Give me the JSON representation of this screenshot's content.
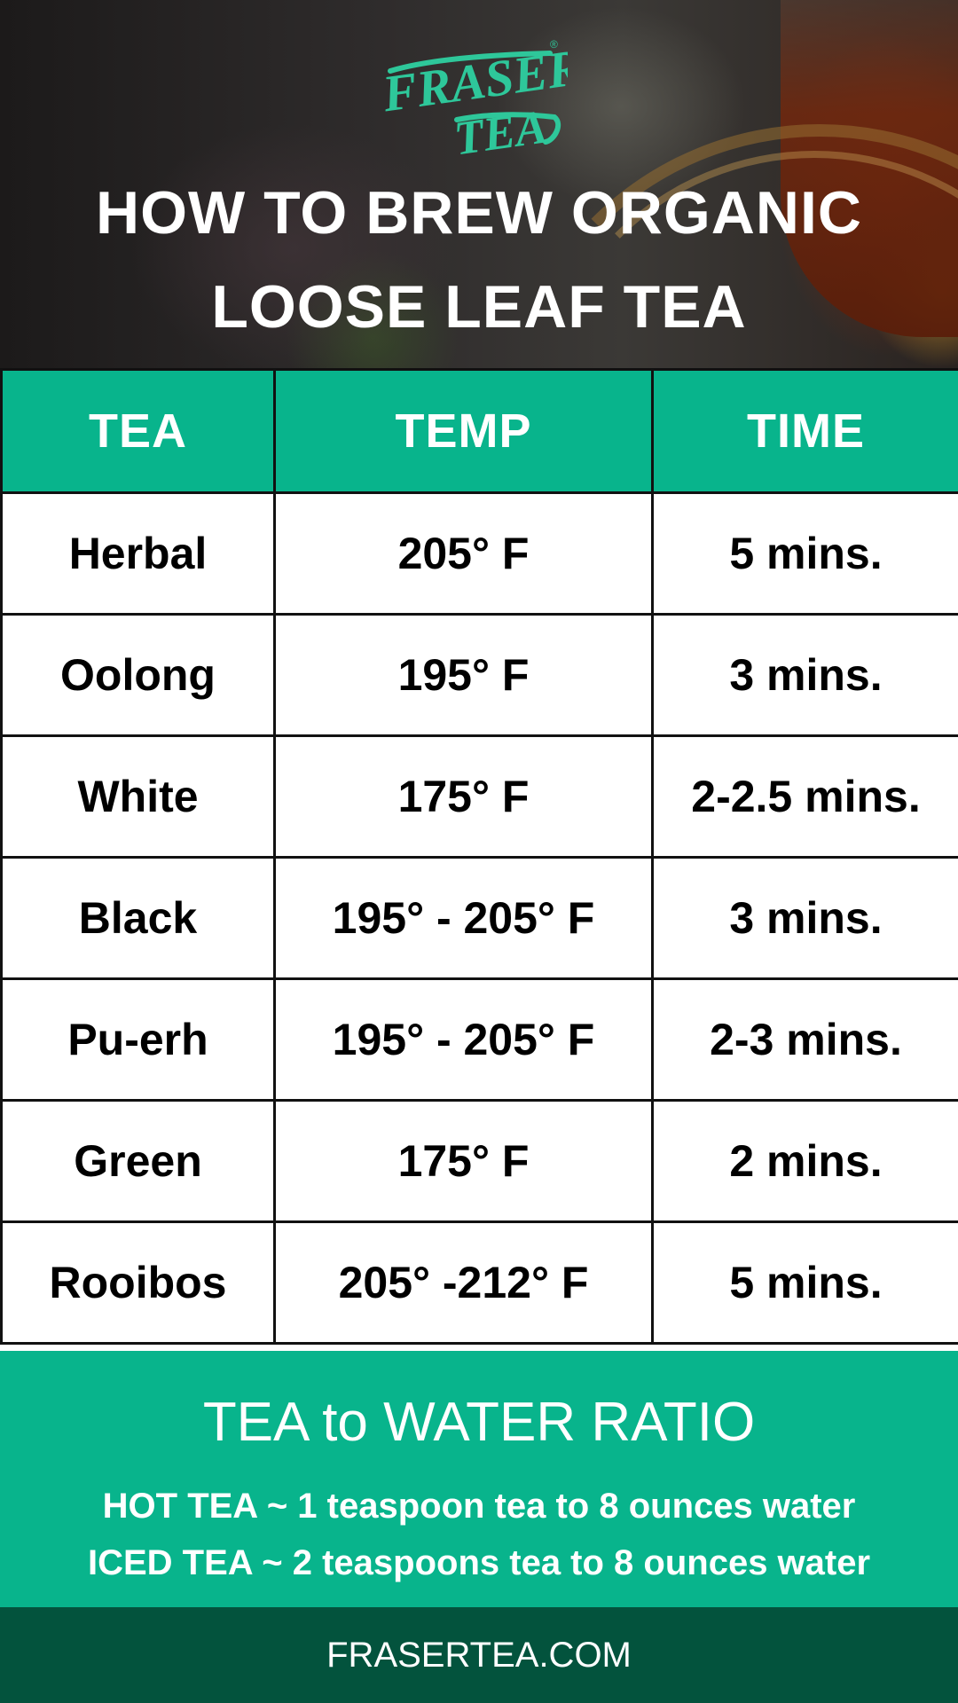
{
  "brand": {
    "logo_line1": "FRASER",
    "logo_line2": "TEA",
    "registered_mark": "®",
    "logo_color": "#2ec79a",
    "accent_color": "#08b48c",
    "footer_color": "#03533d"
  },
  "header": {
    "title_line1": "HOW TO BREW ORGANIC",
    "title_line2": "LOOSE LEAF TEA",
    "background_image": "tea-pouring-photo"
  },
  "table": {
    "columns": [
      "TEA",
      "TEMP",
      "TIME"
    ],
    "rows": [
      {
        "tea": "Herbal",
        "temp": "205° F",
        "time": "5 mins."
      },
      {
        "tea": "Oolong",
        "temp": "195° F",
        "time": "3 mins."
      },
      {
        "tea": "White",
        "temp": "175° F",
        "time": "2-2.5 mins."
      },
      {
        "tea": "Black",
        "temp": "195° - 205° F",
        "time": "3 mins."
      },
      {
        "tea": "Pu-erh",
        "temp": "195° - 205° F",
        "time": "2-3 mins."
      },
      {
        "tea": "Green",
        "temp": "175° F",
        "time": "2 mins."
      },
      {
        "tea": "Rooibos",
        "temp": "205° -212° F",
        "time": "5 mins."
      }
    ]
  },
  "ratio": {
    "heading": "TEA to WATER RATIO",
    "hot": "HOT TEA ~ 1 teaspoon tea to 8 ounces water",
    "iced": "ICED TEA ~ 2 teaspoons tea to 8 ounces water"
  },
  "footer": {
    "website": "FRASERTEA.COM"
  }
}
